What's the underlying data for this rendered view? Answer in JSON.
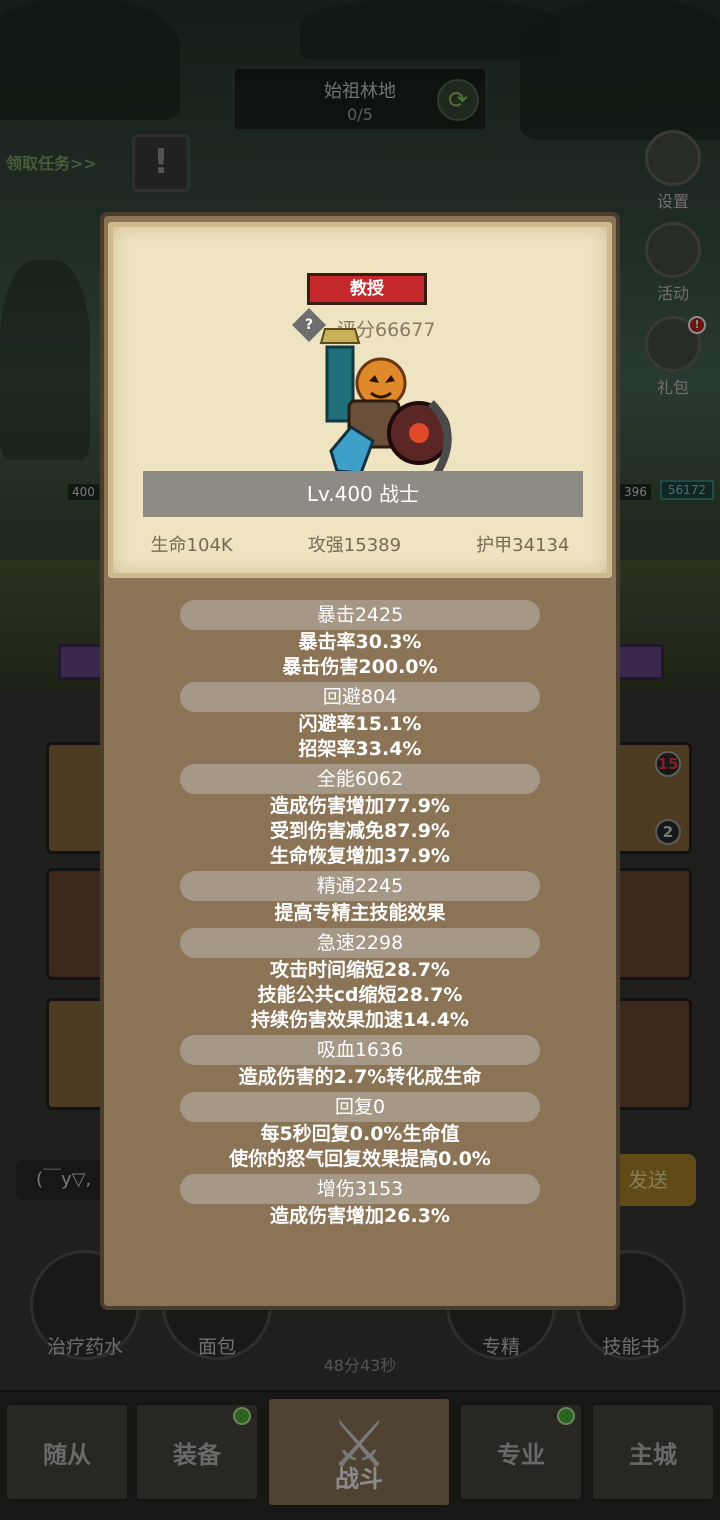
{
  "scene": {
    "stage_name": "始祖林地",
    "stage_progress": "0/5",
    "quest_link": "领取任务>>",
    "side_buttons": [
      "设置",
      "活动",
      "礼包"
    ],
    "gift_badge": "!",
    "left_level": "400",
    "right_level": "396",
    "right_hp": "56172"
  },
  "modal": {
    "title": "教授",
    "score": "评分66677",
    "level_class": "Lv.400 战士",
    "basic_stats": [
      "生命104K",
      "攻强15389",
      "护甲34134"
    ],
    "stats": [
      {
        "header": "暴击2425",
        "lines": [
          "暴击率30.3%",
          "暴击伤害200.0%"
        ]
      },
      {
        "header": "回避804",
        "lines": [
          "闪避率15.1%",
          "招架率33.4%"
        ]
      },
      {
        "header": "全能6062",
        "lines": [
          "造成伤害增加77.9%",
          "受到伤害减免87.9%",
          "生命恢复增加37.9%"
        ]
      },
      {
        "header": "精通2245",
        "lines": [
          "提高专精主技能效果"
        ]
      },
      {
        "header": "急速2298",
        "lines": [
          "攻击时间缩短28.7%",
          "技能公共cd缩短28.7%",
          "持续伤害效果加速14.4%"
        ]
      },
      {
        "header": "吸血1636",
        "lines": [
          "造成伤害的2.7%转化成生命"
        ]
      },
      {
        "header": "回复0",
        "lines": [
          "每5秒回复0.0%生命值",
          "使你的怒气回复效果提高0.0%"
        ]
      },
      {
        "header": "增伤3153",
        "lines": [
          "造成伤害增加26.3%"
        ]
      }
    ]
  },
  "mid": {
    "card_badge_top": "15",
    "card_badge_bottom": "2",
    "chat_text": "(￣y▽,",
    "send_label": "发送",
    "item_slots": [
      "治疗药水",
      "面包",
      "专精",
      "技能书"
    ],
    "timer": "48分43秒"
  },
  "nav": {
    "tabs": [
      "随从",
      "装备",
      "战斗",
      "专业",
      "主城"
    ]
  }
}
